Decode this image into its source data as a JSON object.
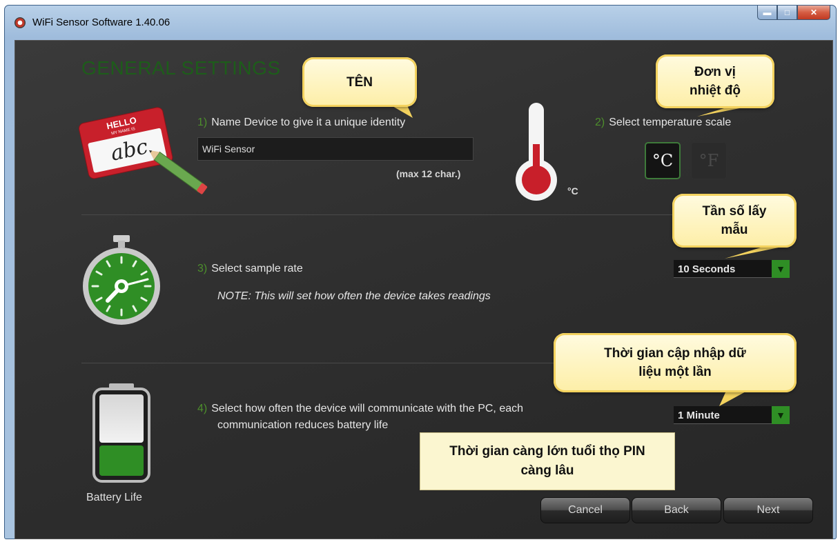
{
  "window": {
    "title": "WiFi Sensor Software 1.40.06",
    "min_glyph": "▬",
    "max_glyph": "□",
    "close_glyph": "✕"
  },
  "page": {
    "heading": "GENERAL SETTINGS"
  },
  "step1": {
    "number": "1)",
    "label": "Name Device to give it a unique identity",
    "input_value": "WiFi Sensor",
    "hint": "(max 12 char.)",
    "name_tag": {
      "hello": "HELLO",
      "my_name_is": "MY NAME IS",
      "written": "abc"
    }
  },
  "step2": {
    "number": "2)",
    "label": "Select temperature scale",
    "current_unit": "°C",
    "celsius_button": "°C",
    "fahrenheit_button": "°F"
  },
  "step3": {
    "number": "3)",
    "label": "Select sample rate",
    "note": "NOTE: This will set how often the device takes readings",
    "selected": "10 Seconds"
  },
  "step4": {
    "number": "4)",
    "label_line1": "Select how often the device will communicate with the PC, each",
    "label_line2": "communication reduces battery life",
    "selected": "1 Minute",
    "battery_label": "Battery Life"
  },
  "buttons": {
    "cancel": "Cancel",
    "back": "Back",
    "next": "Next"
  },
  "callouts": {
    "name": "TÊN",
    "temp_unit": "Đơn vị\nnhiệt độ",
    "sample_rate": "Tần số lấy\nmẫu",
    "update_time": "Thời gian cập nhập dữ\nliệu một lần",
    "battery_note": "Thời gian càng lớn tuổi thọ PIN\ncàng lâu"
  },
  "icons": {
    "dropdown_arrow": "▼"
  },
  "colors": {
    "accent_green": "#2f8e25",
    "step_number_green": "#4d8f2c",
    "heading_green": "#1d5d1a",
    "callout_yellow": "#fdeea6"
  }
}
